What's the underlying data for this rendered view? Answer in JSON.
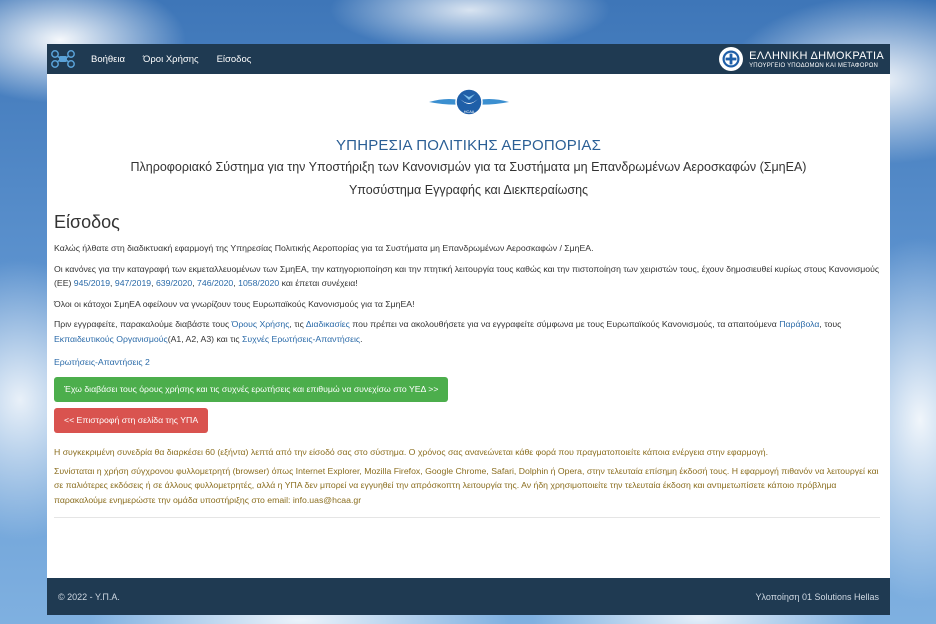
{
  "nav": {
    "links": [
      "Βοήθεια",
      "Όροι Χρήσης",
      "Είσοδος"
    ],
    "gov_title": "ΕΛΛΗΝΙΚΗ ΔΗΜΟΚΡΑΤΙΑ",
    "gov_subtitle": "ΥΠΟΥΡΓΕΙΟ ΥΠΟΔΟΜΩΝ ΚΑΙ ΜΕΤΑΦΟΡΩΝ"
  },
  "header": {
    "logo_text": "HCAA",
    "agency": "ΥΠΗΡΕΣΙΑ ΠΟΛΙΤΙΚΗΣ ΑΕΡΟΠΟΡΙΑΣ",
    "system": "Πληροφοριακό Σύστημα για την Υποστήριξη των Κανονισμών για τα Συστήματα μη Επανδρωμένων Αεροσκαφών (ΣμηΕΑ)",
    "subsystem": "Υποσύστημα Εγγραφής και Διεκπεραίωσης"
  },
  "login": {
    "title": "Είσοδος",
    "welcome": "Καλώς ήλθατε στη διαδικτυακή εφαρμογή της Υπηρεσίας Πολιτικής Αεροπορίας για τα Συστήματα μη Επανδρωμένων Αεροσκαφών / ΣμηΕΑ.",
    "rules_before": "Οι κανόνες για την καταγραφή των εκμεταλλευομένων των ΣμηΕΑ, την κατηγοριοποίηση και την πτητική λειτουργία τους καθώς και την πιστοποίηση των χειριστών τους, έχουν δημοσιευθεί κυρίως στους Κανονισμούς (ΕΕ) ",
    "regulations": [
      "945/2019",
      "947/2019",
      "639/2020",
      "746/2020",
      "1058/2020"
    ],
    "rules_after": " και έπεται συνέχεια!",
    "obligation": "Όλοι οι κάτοχοι ΣμηΕΑ οφείλουν να γνωρίζουν τους Ευρωπαϊκούς Κανονισμούς για τα ΣμηΕΑ!",
    "instr_1": "Πριν εγγραφείτε, παρακαλούμε διαβάστε τους ",
    "link_terms": "Όρους Χρήσης",
    "instr_2": ", τις ",
    "link_procedures": "Διαδικασίες",
    "instr_3": " που πρέπει να ακολουθήσετε για να εγγραφείτε σύμφωνα με τους Ευρωπαϊκούς Κανονισμούς, τα απαιτούμενα ",
    "link_fees": "Παράβολα",
    "instr_4": ", τους ",
    "link_training": "Εκπαιδευτικούς Οργανισμούς",
    "instr_5": "(A1, A2, A3) και τις ",
    "link_faq": "Συχνές Ερωτήσεις-Απαντήσεις",
    "instr_6": ".",
    "faq2": "Ερωτήσεις-Απαντήσεις 2",
    "btn_continue": "Έχω διαβάσει τους όρους χρήσης και τις συχνές ερωτήσεις και επιθυμώ να συνεχίσω στο ΥΕΔ >>",
    "btn_back": "<< Επιστροφή στη σελίδα της ΥΠΑ",
    "session_notice": "Η συγκεκριμένη συνεδρία θα διαρκέσει 60 (εξήντα) λεπτά από την είσοδό σας στο σύστημα. Ο χρόνος σας ανανεώνεται κάθε φορά που πραγματοποιείτε κάποια ενέργεια στην εφαρμογή.",
    "browser_notice": "Συνίσταται η χρήση σύγχρονου φυλλομετρητή (browser) όπως Internet Explorer, Mozilla Firefox, Google Chrome, Safari, Dolphin ή Opera, στην τελευταία επίσημη έκδοσή τους. Η εφαρμογή πιθανόν να λειτουργεί και σε παλιότερες εκδόσεις ή σε άλλους φυλλομετρητές, αλλά η ΥΠΑ δεν μπορεί να εγγυηθεί την απρόσκοπτη λειτουργία της. Αν ήδη χρησιμοποιείτε την τελευταία έκδοση και αντιμετωπίσετε κάποιο πρόβλημα παρακαλούμε ενημερώστε την ομάδα υποστήριξης στο email: info.uas@hcaa.gr"
  },
  "footer": {
    "copyright": "© 2022 - Υ.Π.Α.",
    "credit": "Υλοποίηση 01 Solutions Hellas"
  },
  "colors": {
    "navbar": "#1f3a52",
    "link": "#2a6aa8",
    "success": "#4cae4c",
    "danger": "#d9534f",
    "notice": "#8a6d1e"
  },
  "icons": [
    "drone-icon",
    "greek-emblem-icon",
    "hcaa-logo"
  ]
}
